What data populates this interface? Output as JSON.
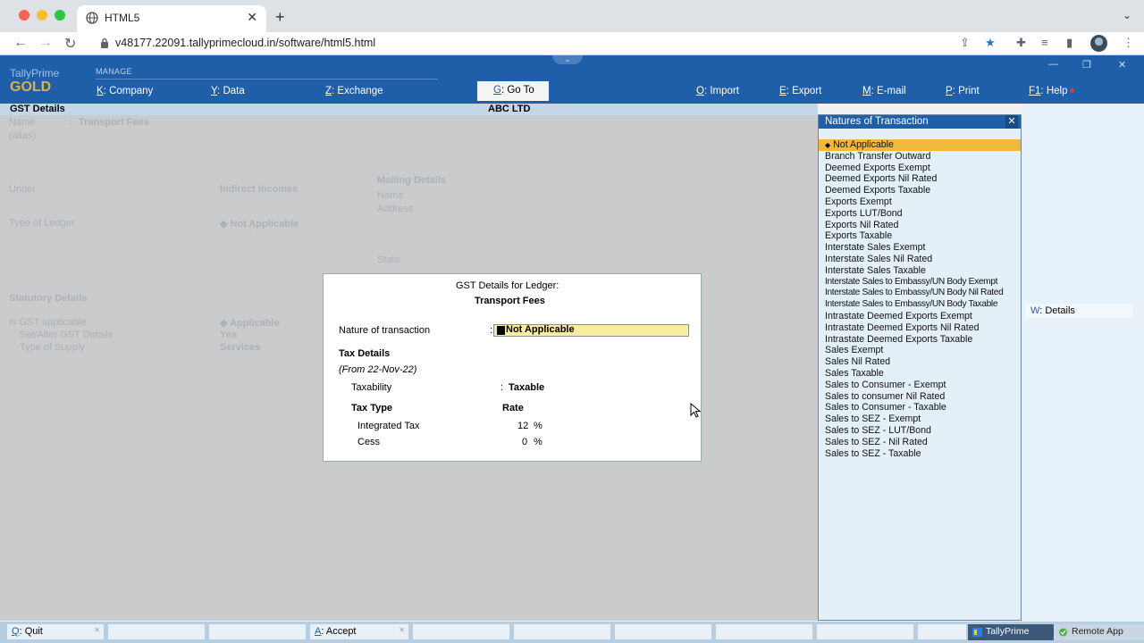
{
  "browser": {
    "tab_title": "HTML5",
    "url": "v48177.22091.tallyprimecloud.in/software/html5.html"
  },
  "app": {
    "logo_line1": "TallyPrime",
    "logo_line2": "GOLD",
    "manage_label": "MANAGE",
    "menu": [
      {
        "key": "K",
        "label": "Company"
      },
      {
        "key": "Y",
        "label": "Data"
      },
      {
        "key": "Z",
        "label": "Exchange"
      },
      {
        "key": "G",
        "label": "Go To"
      },
      {
        "key": "O",
        "label": "Import"
      },
      {
        "key": "E",
        "label": "Export"
      },
      {
        "key": "M",
        "label": "E-mail"
      },
      {
        "key": "P",
        "label": "Print"
      },
      {
        "key": "F1",
        "label": "Help"
      }
    ]
  },
  "screen": {
    "title": "GST Details",
    "company": "ABC LTD"
  },
  "background": {
    "name_label": "Name",
    "name_value": "Transport Fees",
    "alias_label": "(alias)",
    "under_label": "Under",
    "under_value": "Indirect Incomes",
    "type_label": "Type of Ledger",
    "type_value": "Not Applicable",
    "mailing_title": "Mailing Details",
    "mailing_name": "Name",
    "mailing_address": "Address",
    "mailing_state": "State",
    "statutory_title": "Statutory Details",
    "gst_applicable_label": "Is GST applicable",
    "gst_applicable_value": "Applicable",
    "set_alter_label": "Set/Alter GST Details",
    "set_alter_value": "Yes",
    "supply_label": "Type of Supply",
    "supply_value": "Services"
  },
  "dialog": {
    "title": "GST Details for Ledger:",
    "ledger": "Transport Fees",
    "nature_label": "Nature of transaction",
    "nature_value": "Not Applicable",
    "tax_details": "Tax Details",
    "from_date": "(From 22-Nov-22)",
    "taxability_label": "Taxability",
    "taxability_value": "Taxable",
    "tax_type_header": "Tax Type",
    "rate_header": "Rate",
    "rows": [
      {
        "type": "Integrated Tax",
        "rate": "12",
        "unit": "%"
      },
      {
        "type": "Cess",
        "rate": "0",
        "unit": "%"
      }
    ]
  },
  "panel": {
    "title": "Natures of Transaction",
    "items": [
      "Not Applicable",
      "Branch Transfer Outward",
      "Deemed Exports Exempt",
      "Deemed Exports Nil Rated",
      "Deemed Exports Taxable",
      "Exports Exempt",
      "Exports LUT/Bond",
      "Exports Nil Rated",
      "Exports Taxable",
      "Interstate Sales Exempt",
      "Interstate Sales Nil Rated",
      "Interstate Sales Taxable",
      "Interstate Sales to Embassy/UN Body Exempt",
      "Interstate Sales to Embassy/UN Body Nil Rated",
      "Interstate Sales to Embassy/UN Body Taxable",
      "Intrastate Deemed Exports Exempt",
      "Intrastate Deemed Exports Nil Rated",
      "Intrastate Deemed Exports Taxable",
      "Sales Exempt",
      "Sales Nil Rated",
      "Sales Taxable",
      "Sales to Consumer - Exempt",
      "Sales to consumer Nil Rated",
      "Sales to Consumer - Taxable",
      "Sales to SEZ - Exempt",
      "Sales to SEZ - LUT/Bond",
      "Sales to SEZ - Nil Rated",
      "Sales to SEZ - Taxable"
    ],
    "selected_index": 0
  },
  "side": {
    "details_key": "W",
    "details_label": "Details"
  },
  "bottom": {
    "quit_key": "Q",
    "quit_label": "Quit",
    "accept_key": "A",
    "accept_label": "Accept"
  },
  "taskbar": {
    "tally": "TallyPrime",
    "remote": "Remote App"
  },
  "colors": {
    "accent": "#1f5ea8",
    "selection": "#f0b93a",
    "field_highlight": "#fbeea0",
    "gold": "#d9b24c"
  }
}
